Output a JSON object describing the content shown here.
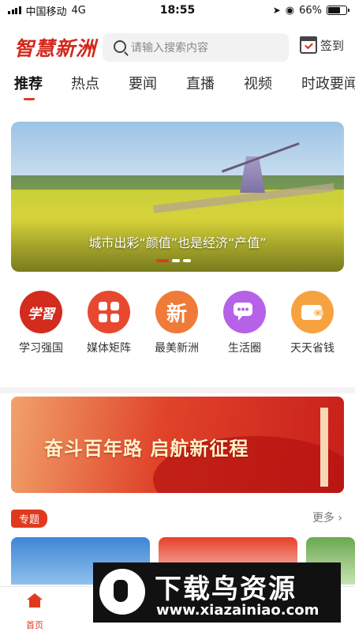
{
  "status_bar": {
    "carrier": "中国移动",
    "network": "4G",
    "time": "18:55",
    "battery_percent": "66%",
    "battery_level": 0.66
  },
  "header": {
    "logo_text": "智慧新洲",
    "search_placeholder": "请输入搜索内容",
    "checkin_label": "签到"
  },
  "tabs": [
    {
      "label": "推荐",
      "active": true
    },
    {
      "label": "热点",
      "active": false
    },
    {
      "label": "要闻",
      "active": false
    },
    {
      "label": "直播",
      "active": false
    },
    {
      "label": "视频",
      "active": false
    },
    {
      "label": "时政要闻",
      "active": false
    }
  ],
  "banner": {
    "caption": "城市出彩“颜值”也是经济“产值”",
    "slide_count": 3,
    "active_slide": 1
  },
  "quick_links": [
    {
      "label": "学习强国",
      "icon": "study-icon",
      "icon_text": "学習",
      "color": "#d42b1f"
    },
    {
      "label": "媒体矩阵",
      "icon": "grid-icon",
      "icon_text": "",
      "color": "#e8482f"
    },
    {
      "label": "最美新洲",
      "icon": "xin-icon",
      "icon_text": "新",
      "color": "#f07a38"
    },
    {
      "label": "生活圈",
      "icon": "chat-icon",
      "icon_text": "",
      "color": "#b562e8"
    },
    {
      "label": "天天省钱",
      "icon": "wallet-icon",
      "icon_text": "",
      "color": "#f6a23e"
    }
  ],
  "ad_banner": {
    "text": "奋斗百年路  启航新征程"
  },
  "topics": {
    "tag": "专题",
    "more_label": "更多"
  },
  "bottom_nav": {
    "home_label": "首页"
  },
  "watermark": {
    "title": "下载鸟资源",
    "url": "www.xiazainiao.com"
  },
  "colors": {
    "accent": "#e03a1e",
    "logo_red": "#d2281c"
  }
}
